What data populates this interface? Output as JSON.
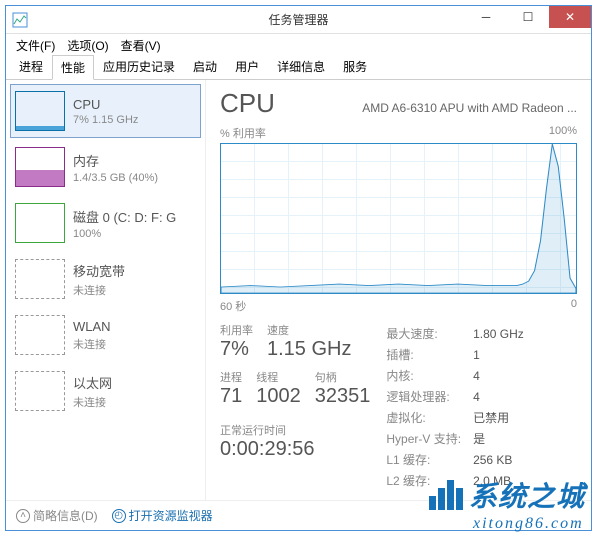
{
  "window": {
    "title": "任务管理器"
  },
  "menu": {
    "file": "文件(F)",
    "options": "选项(O)",
    "view": "查看(V)"
  },
  "tabs": [
    "进程",
    "性能",
    "应用历史记录",
    "启动",
    "用户",
    "详细信息",
    "服务"
  ],
  "activeTab": 1,
  "sidebar": {
    "items": [
      {
        "title": "CPU",
        "sub": "7% 1.15 GHz"
      },
      {
        "title": "内存",
        "sub": "1.4/3.5 GB (40%)"
      },
      {
        "title": "磁盘 0 (C: D: F: G",
        "sub": "100%"
      },
      {
        "title": "移动宽带",
        "sub": "未连接"
      },
      {
        "title": "WLAN",
        "sub": "未连接"
      },
      {
        "title": "以太网",
        "sub": "未连接"
      }
    ]
  },
  "detail": {
    "title": "CPU",
    "subtitle": "AMD A6-6310 APU with AMD Radeon ...",
    "chartTop": {
      "left": "% 利用率",
      "right": "100%"
    },
    "chartBottom": {
      "left": "60 秒",
      "right": "0"
    },
    "stats": {
      "util_label": "利用率",
      "util": "7%",
      "speed_label": "速度",
      "speed": "1.15 GHz",
      "proc_label": "进程",
      "proc": "71",
      "threads_label": "线程",
      "threads": "1002",
      "handles_label": "句柄",
      "handles": "32351",
      "uptime_label": "正常运行时间",
      "uptime": "0:00:29:56"
    },
    "right": {
      "maxspeed_k": "最大速度:",
      "maxspeed_v": "1.80 GHz",
      "sockets_k": "插槽:",
      "sockets_v": "1",
      "cores_k": "内核:",
      "cores_v": "4",
      "logical_k": "逻辑处理器:",
      "logical_v": "4",
      "virt_k": "虚拟化:",
      "virt_v": "已禁用",
      "hyperv_k": "Hyper-V 支持:",
      "hyperv_v": "是",
      "l1_k": "L1 缓存:",
      "l1_v": "256 KB",
      "l2_k": "L2 缓存:",
      "l2_v": "2.0 MB"
    }
  },
  "footer": {
    "fewer": "简略信息(D)",
    "resmon": "打开资源监视器"
  },
  "watermark": {
    "line1": "系统之城",
    "line2": "xitong86.com"
  },
  "chart_data": {
    "type": "line",
    "title": "% 利用率",
    "xlabel": "60 秒",
    "ylabel": "",
    "ylim": [
      0,
      100
    ],
    "x": [
      0,
      5,
      10,
      15,
      20,
      25,
      30,
      35,
      40,
      45,
      50,
      51,
      52,
      53,
      54,
      55,
      56,
      57,
      58,
      59,
      60
    ],
    "values": [
      4,
      5,
      4,
      5,
      6,
      5,
      6,
      5,
      6,
      5,
      5,
      6,
      8,
      15,
      35,
      70,
      100,
      85,
      50,
      10,
      3
    ]
  }
}
